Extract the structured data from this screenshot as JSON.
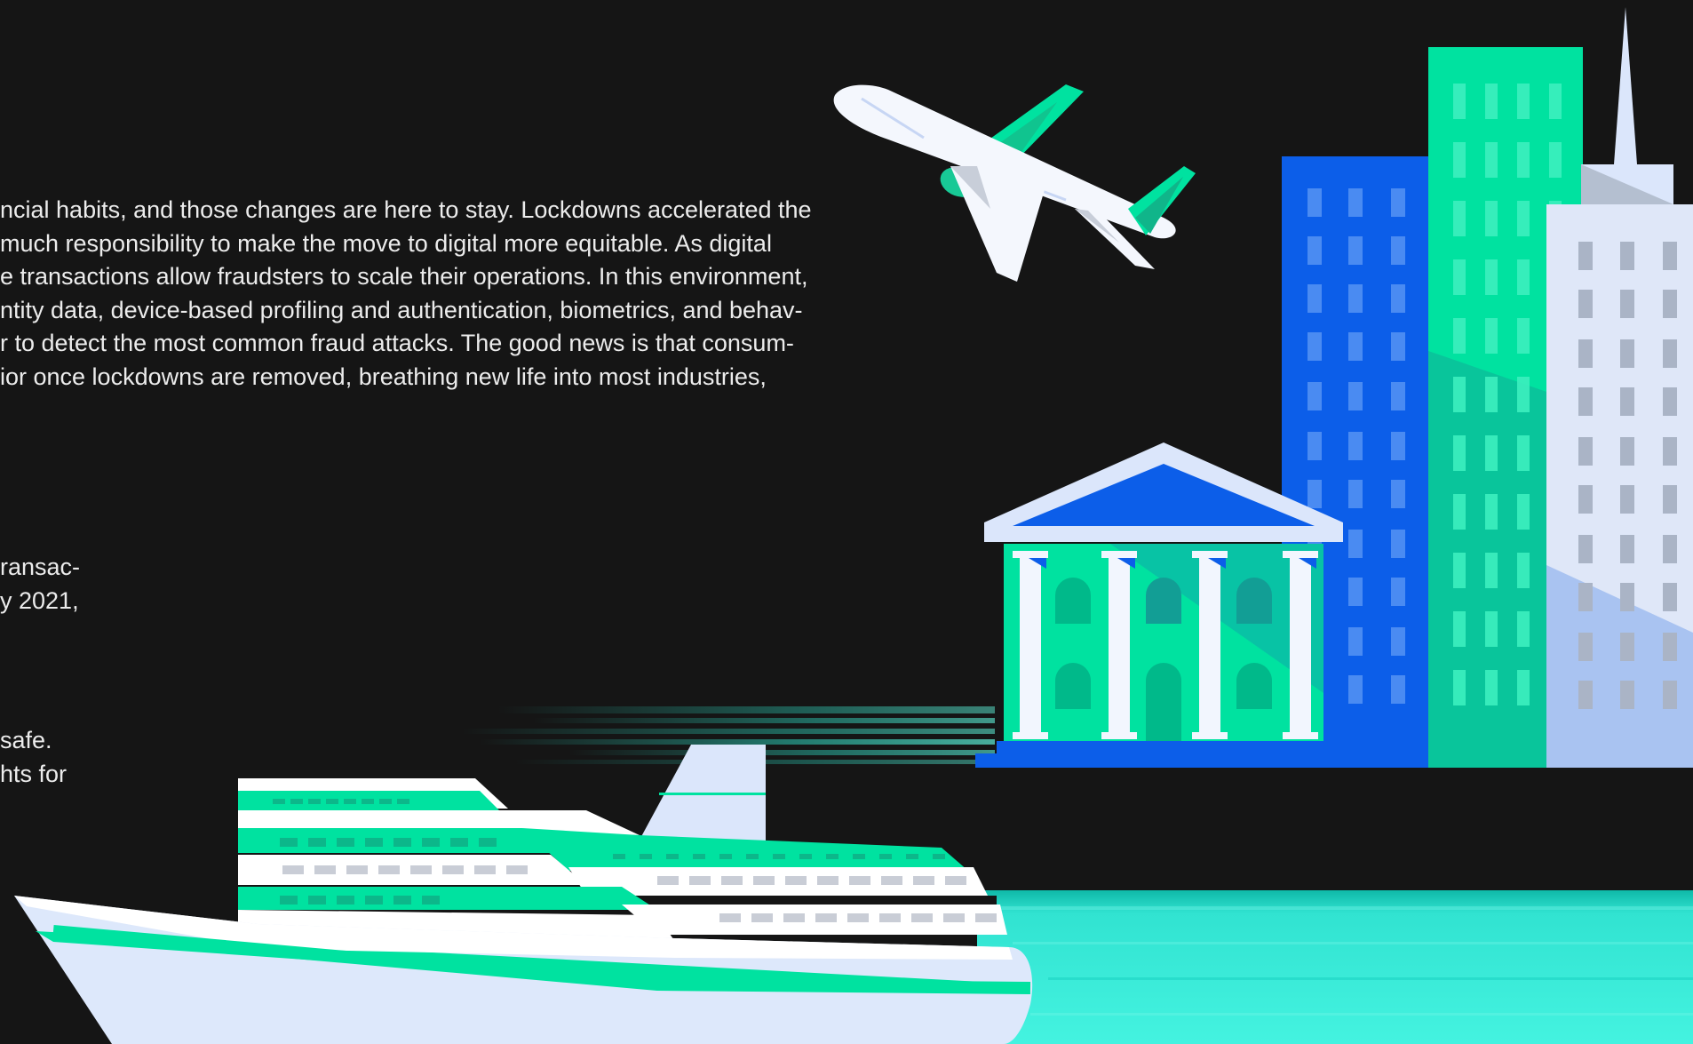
{
  "paragraphs": {
    "intro_lines": [
      "ncial habits, and those changes are here to stay. Lockdowns accelerated the",
      "much responsibility to make the move to digital more equitable. As digital",
      "e transactions allow fraudsters to scale their operations. In this environment,",
      "ntity data, device-based profiling and authentication, biometrics, and behav-",
      "r to detect the most common fraud attacks. The good news is that consum-",
      "ior once lockdowns are removed, breathing new life into most industries,"
    ],
    "middle_lines": [
      "ransac-",
      "y 2021,"
    ],
    "lower_lines": [
      "safe.",
      "hts for"
    ]
  },
  "colors": {
    "background": "#151515",
    "text": "#ececec",
    "accent_green": "#00e0a0",
    "accent_blue": "#0b5fe8",
    "light": "#dde8fb",
    "water": "#3ff0dc"
  },
  "icons": [
    "airplane-illustration",
    "bank-building-illustration",
    "city-skyline-illustration",
    "cruise-ship-illustration",
    "water-illustration"
  ]
}
